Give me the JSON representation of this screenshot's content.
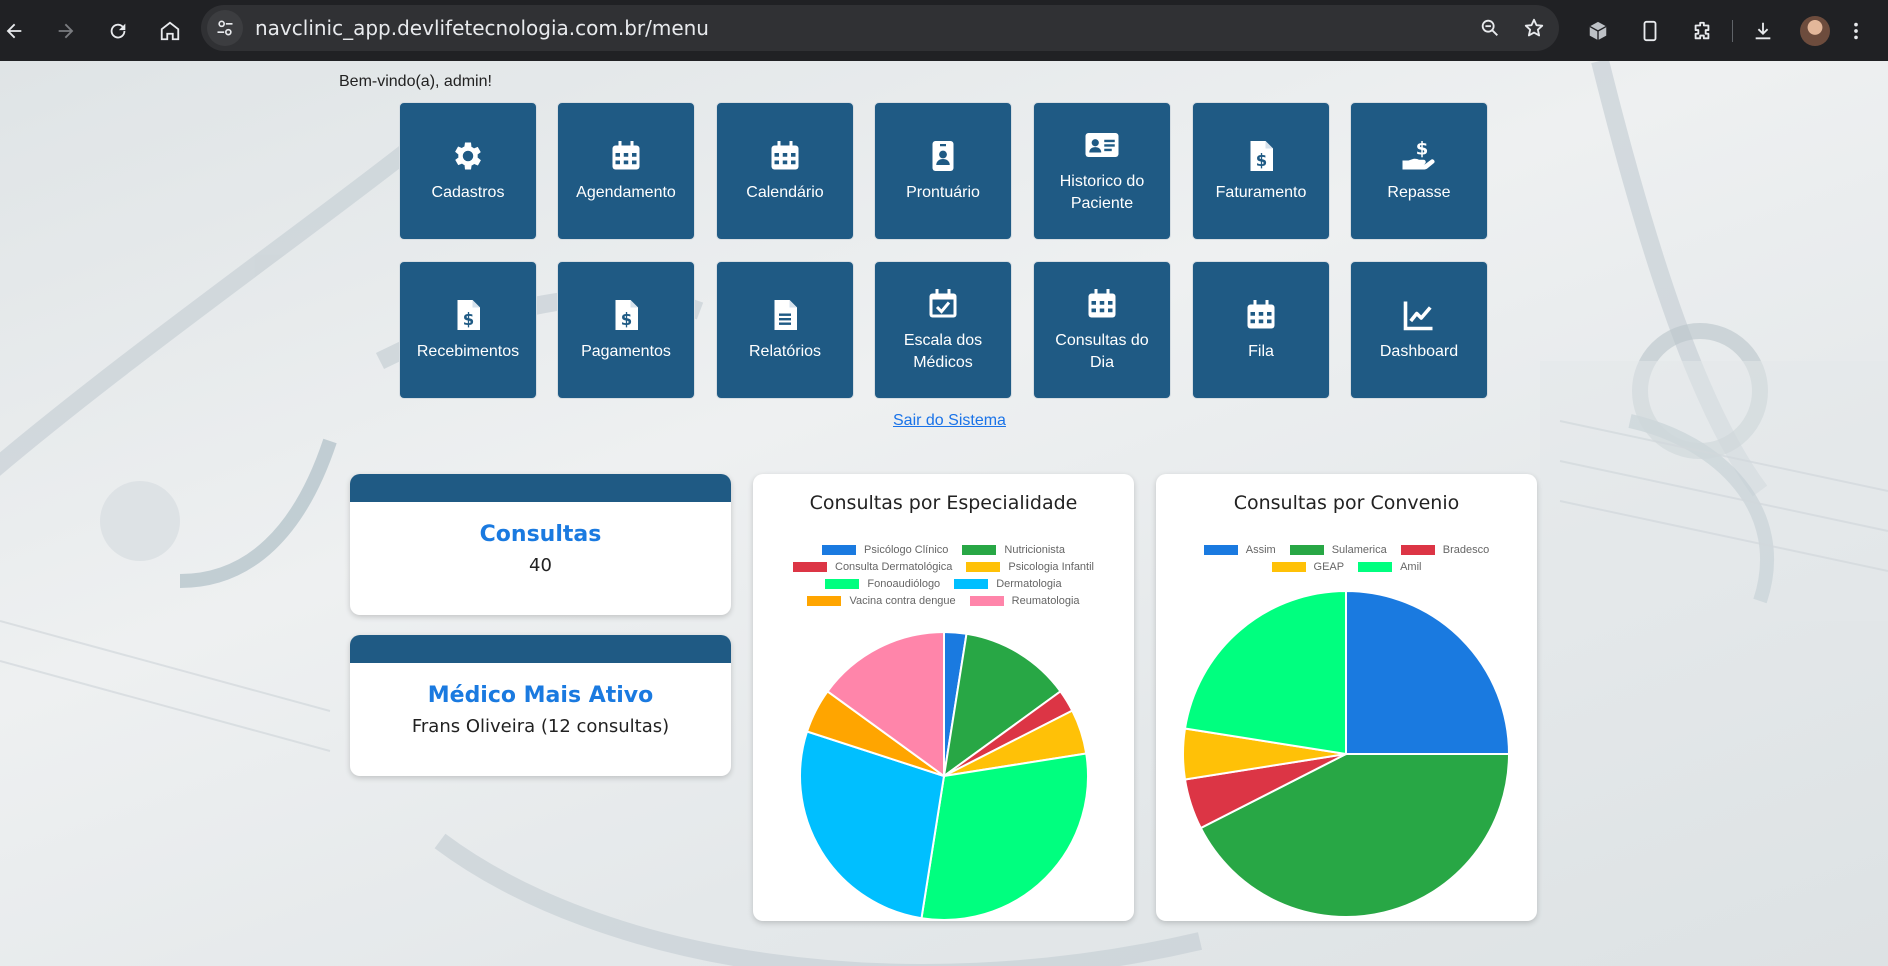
{
  "browser": {
    "url": "navclinic_app.devlifetecnologia.com.br/menu"
  },
  "welcome": "Bem-vindo(a), admin!",
  "menu": [
    {
      "label": "Cadastros",
      "icon": "gear-icon"
    },
    {
      "label": "Agendamento",
      "icon": "calendar-icon"
    },
    {
      "label": "Calendário",
      "icon": "calendar-icon"
    },
    {
      "label": "Prontuário",
      "icon": "id-badge-icon"
    },
    {
      "label": "Historico do Paciente",
      "icon": "id-card-icon"
    },
    {
      "label": "Faturamento",
      "icon": "invoice-dollar-icon"
    },
    {
      "label": "Repasse",
      "icon": "hand-dollar-icon"
    },
    {
      "label": "Recebimentos",
      "icon": "invoice-dollar-icon"
    },
    {
      "label": "Pagamentos",
      "icon": "invoice-dollar-icon"
    },
    {
      "label": "Relatórios",
      "icon": "document-icon"
    },
    {
      "label": "Escala dos Médicos",
      "icon": "calendar-check-icon"
    },
    {
      "label": "Consultas do Dia",
      "icon": "calendar-icon"
    },
    {
      "label": "Fila",
      "icon": "calendar-icon"
    },
    {
      "label": "Dashboard",
      "icon": "line-chart-icon"
    }
  ],
  "logout": "Sair do Sistema",
  "stats": {
    "consultas": {
      "title": "Consultas",
      "value": "40"
    },
    "medico": {
      "title": "Médico Mais Ativo",
      "value": "Frans Oliveira (12 consultas)"
    }
  },
  "chart_data": [
    {
      "type": "pie",
      "title": "Consultas por Especialidade",
      "categories": [
        "Psicólogo Clínico",
        "Nutricionista",
        "Consulta Dermatológica",
        "Psicologia Infantil",
        "Fonoaudiólogo",
        "Dermatologia",
        "Vacina contra dengue",
        "Reumatologia"
      ],
      "values": [
        1,
        5,
        1,
        2,
        12,
        11,
        2,
        6
      ],
      "colors": [
        "#1a7ae0",
        "#28a745",
        "#dc3545",
        "#ffc107",
        "#00ff7f",
        "#00bfff",
        "#ffa500",
        "#ff85aa"
      ],
      "legend": "top"
    },
    {
      "type": "pie",
      "title": "Consultas por Convenio",
      "categories": [
        "Assim",
        "Sulamerica",
        "Bradesco",
        "GEAP",
        "Amil"
      ],
      "values": [
        10,
        17,
        2,
        2,
        9
      ],
      "colors": [
        "#1a7ae0",
        "#28a745",
        "#dc3545",
        "#ffc107",
        "#00ff7f"
      ],
      "legend": "top"
    }
  ]
}
